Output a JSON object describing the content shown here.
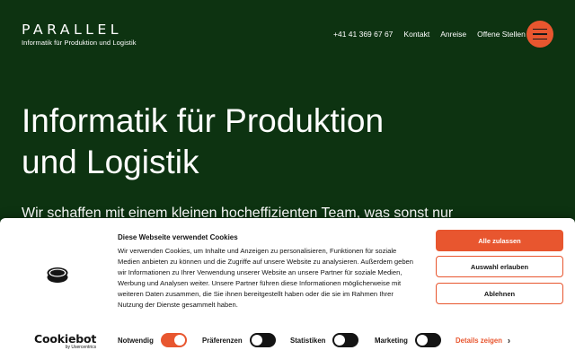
{
  "header": {
    "logo_text": "PARALLEL",
    "tagline": "Informatik für Produktion und Logistik",
    "nav": [
      {
        "label": "+41 41 369 67 67"
      },
      {
        "label": "Kontakt"
      },
      {
        "label": "Anreise"
      },
      {
        "label": "Offene Stellen"
      }
    ],
    "menu_icon": "hamburger-icon"
  },
  "hero": {
    "headline_line1": "Informatik für Produktion",
    "headline_line2": "und Logistik",
    "subline": "Wir schaffen mit einem kleinen hocheffizienten Team, was sonst nur"
  },
  "cookie_banner": {
    "brand": "Cookiebot",
    "brand_by": "by Usercentrics",
    "title": "Diese Webseite verwendet Cookies",
    "text": "Wir verwenden Cookies, um Inhalte und Anzeigen zu personalisieren, Funktionen für soziale Medien anbieten zu können und die Zugriffe auf unsere Website zu analysieren. Außerdem geben wir Informationen zu Ihrer Verwendung unserer Website an unsere Partner für soziale Medien, Werbung und Analysen weiter. Unsere Partner führen diese Informationen möglicherweise mit weiteren Daten zusammen, die Sie ihnen bereitgestellt haben oder die sie im Rahmen Ihrer Nutzung der Dienste gesammelt haben.",
    "buttons": {
      "allow_all": "Alle zulassen",
      "allow_selection": "Auswahl erlauben",
      "decline": "Ablehnen"
    },
    "toggles": [
      {
        "label": "Notwendig",
        "on": true
      },
      {
        "label": "Präferenzen",
        "on": false
      },
      {
        "label": "Statistiken",
        "on": false
      },
      {
        "label": "Marketing",
        "on": false
      }
    ],
    "details_label": "Details zeigen"
  },
  "colors": {
    "background": "#0d3311",
    "accent": "#e8562f",
    "text_dark": "#141414"
  }
}
